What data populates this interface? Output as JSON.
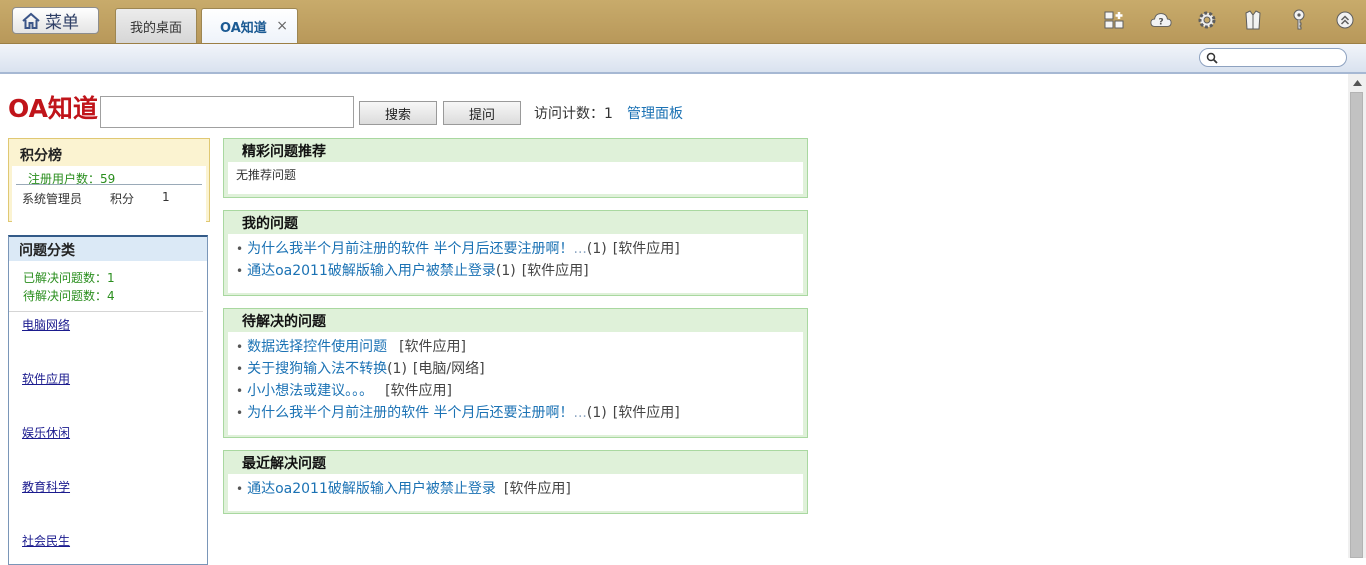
{
  "topbar": {
    "menu_label": "菜单",
    "tabs": [
      {
        "label": "我的桌面"
      },
      {
        "label": "OA知道",
        "close": "×"
      }
    ],
    "tool_icons": [
      "layout-icon",
      "cloud-help-icon",
      "gear-icon",
      "shirt-icon",
      "key-icon",
      "chevron-up-circle-icon"
    ]
  },
  "subbar": {
    "search_placeholder": ""
  },
  "header": {
    "brand": "OA知道",
    "search_value": "",
    "search_button": "搜索",
    "ask_button": "提问",
    "visit_label": "访问计数：1",
    "admin_link": "管理面板"
  },
  "score": {
    "title": "积分榜",
    "users_label": "注册用户数：59",
    "rows": [
      {
        "name": "系统管理员",
        "label": "积分",
        "value": "1"
      }
    ]
  },
  "categories": {
    "title": "问题分类",
    "solved": "已解决问题数：1",
    "pending": "待解决问题数：4",
    "items": [
      "电脑网络",
      "软件应用",
      "娱乐休闲",
      "教育科学",
      "社会民生"
    ]
  },
  "recommend": {
    "title": "精彩问题推荐",
    "empty": "无推荐问题"
  },
  "my_questions": {
    "title": "我的问题",
    "items": [
      {
        "text": "为什么我半个月前注册的软件 半个月后还要注册啊！",
        "more": "...",
        "count": "(1)",
        "category": "[软件应用]"
      },
      {
        "text": "通达oa2011破解版输入用户被禁止登录",
        "more": "",
        "count": "(1)",
        "category": "[软件应用]"
      }
    ]
  },
  "pending_questions": {
    "title": "待解决的问题",
    "items": [
      {
        "text": "数据选择控件使用问题",
        "more": "",
        "count": "",
        "category": "[软件应用]"
      },
      {
        "text": "关于搜狗输入法不转换",
        "more": "",
        "count": "(1)",
        "category": "[电脑/网络]"
      },
      {
        "text": "小小想法或建议。。。",
        "more": "",
        "count": "",
        "category": "[软件应用]"
      },
      {
        "text": "为什么我半个月前注册的软件 半个月后还要注册啊！",
        "more": "...",
        "count": "(1)",
        "category": "[软件应用]"
      }
    ]
  },
  "recent_solved": {
    "title": "最近解决问题",
    "items": [
      {
        "text": "通达oa2011破解版输入用户被禁止登录",
        "more": "",
        "count": "",
        "category": "[软件应用]"
      }
    ]
  }
}
